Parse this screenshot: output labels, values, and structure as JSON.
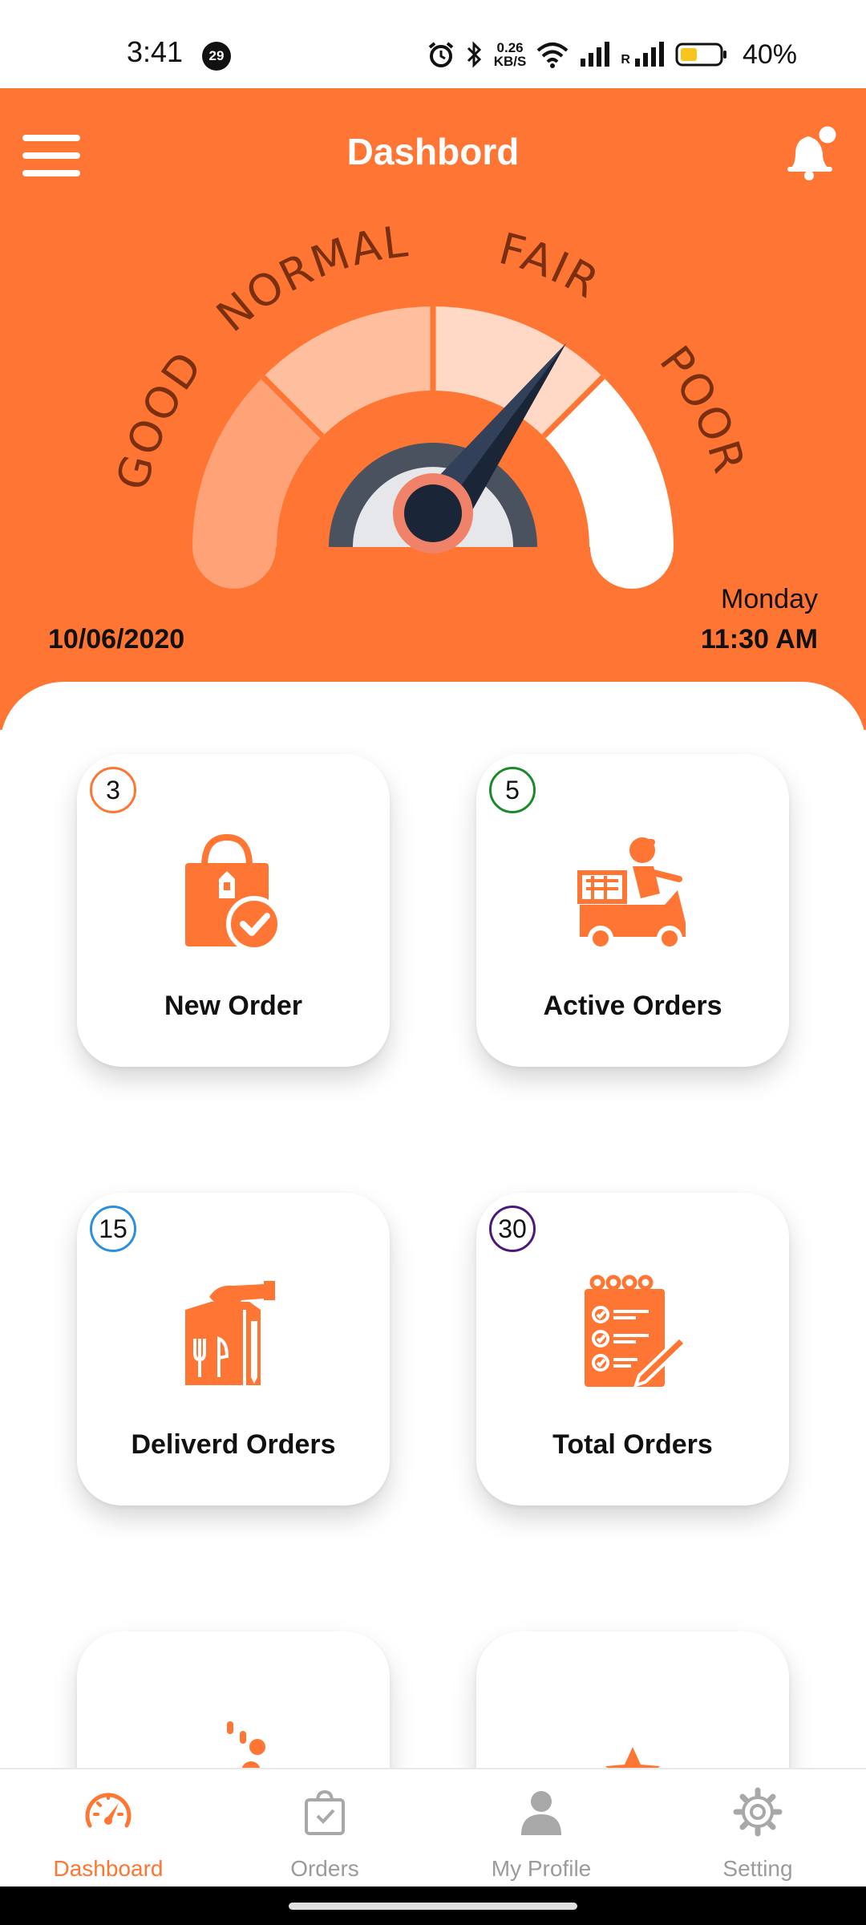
{
  "status_bar": {
    "time": "3:41",
    "notification_count": "29",
    "speed_value": "0.26",
    "speed_unit": "KB/S",
    "battery": "40%",
    "roaming": "R"
  },
  "header": {
    "title": "Dashbord",
    "menu_icon": "hamburger-icon",
    "notification_icon": "bell-icon"
  },
  "gauge": {
    "labels": [
      "GOOD",
      "NORMAL",
      "FAIR",
      "POOR"
    ],
    "needle_segment": "FAIR"
  },
  "datetime": {
    "date": "10/06/2020",
    "day": "Monday",
    "time": "11:30 AM"
  },
  "cards": [
    {
      "label": "New Order",
      "count": "3",
      "badge_color": "#ff7533",
      "icon": "shopping-bag-check-icon"
    },
    {
      "label": "Active Orders",
      "count": "5",
      "badge_color": "#1b8a2a",
      "icon": "delivery-scooter-icon"
    },
    {
      "label": "Deliverd Orders",
      "count": "15",
      "badge_color": "#2b8fe0",
      "icon": "food-bag-handover-icon"
    },
    {
      "label": "Total Orders",
      "count": "30",
      "badge_color": "#4a1a7a",
      "icon": "order-checklist-icon"
    },
    {
      "label": "",
      "count": "",
      "icon": "cooking-icon"
    },
    {
      "label": "",
      "count": "",
      "icon": "rating-stars-icon"
    }
  ],
  "bottom_nav": [
    {
      "label": "Dashboard",
      "icon": "speedometer-icon",
      "active": true
    },
    {
      "label": "Orders",
      "icon": "shopping-bag-icon",
      "active": false
    },
    {
      "label": "My Profile",
      "icon": "person-icon",
      "active": false
    },
    {
      "label": "Setting",
      "icon": "gear-icon",
      "active": false
    }
  ],
  "colors": {
    "brand": "#ff7533",
    "gauge_good": "#ffa277",
    "gauge_normal": "#ffbe9d",
    "gauge_fair": "#ffd9c6",
    "gauge_poor": "#ffffff",
    "needle": "#1a2538",
    "inactive": "#9b9b9b"
  }
}
